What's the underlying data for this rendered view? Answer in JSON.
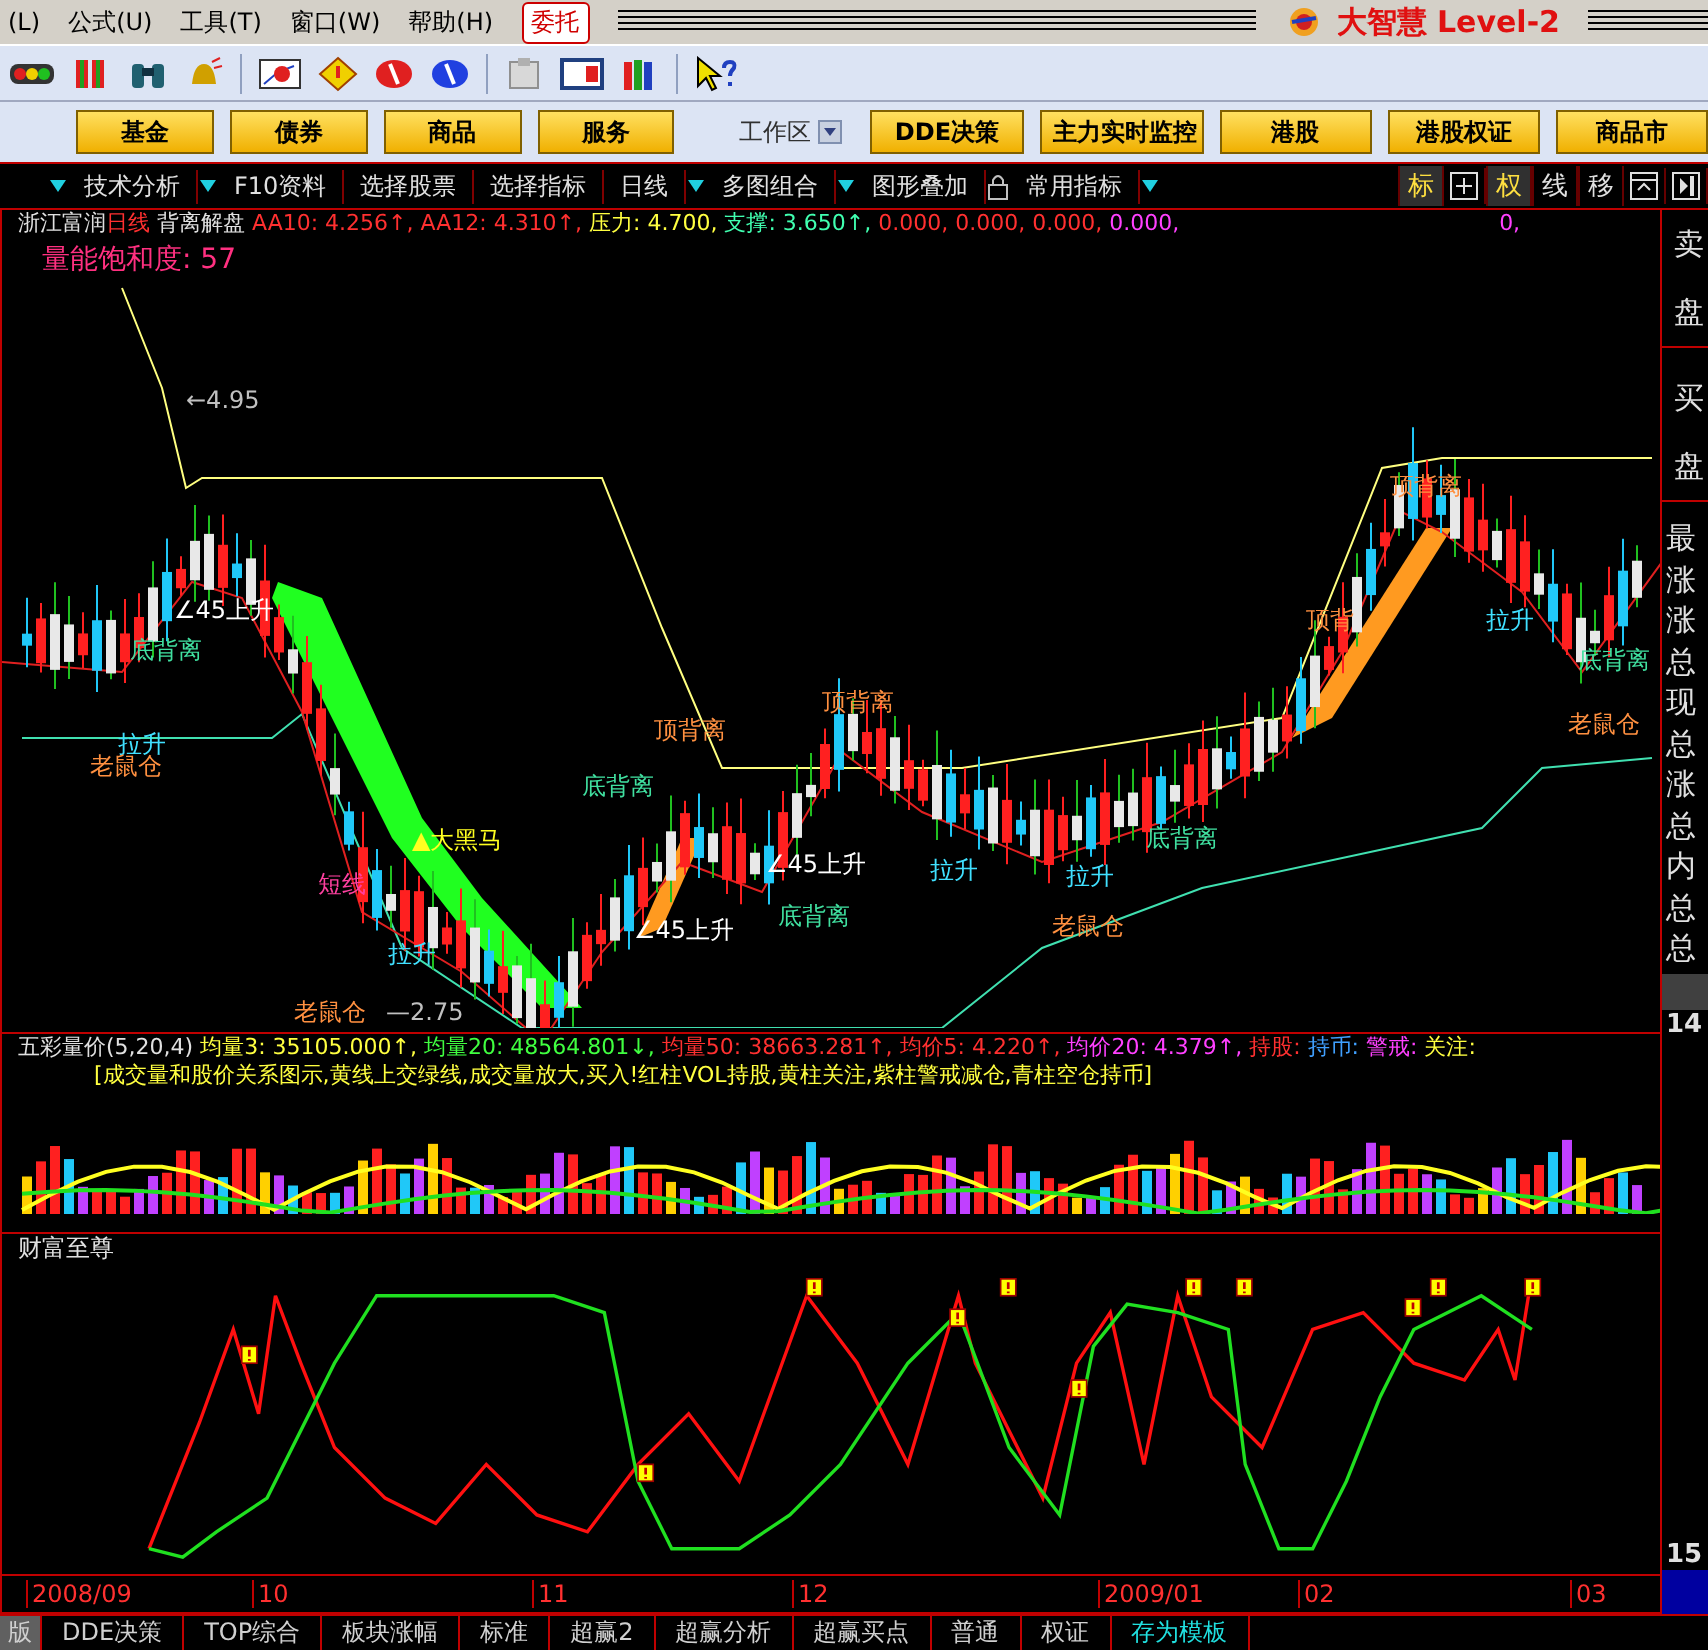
{
  "menu": {
    "items": [
      "(L)",
      "公式(U)",
      "工具(T)",
      "窗口(W)",
      "帮助(H)"
    ],
    "trade_button": "委托",
    "app_title": "大智慧 Level-2"
  },
  "category_bar": [
    {
      "kind": "button",
      "label": "基金"
    },
    {
      "kind": "button",
      "label": "债券"
    },
    {
      "kind": "button",
      "label": "商品"
    },
    {
      "kind": "button",
      "label": "服务"
    },
    {
      "kind": "menu",
      "label": "工作区"
    },
    {
      "kind": "button",
      "label": "DDE决策"
    },
    {
      "kind": "button",
      "label": "主力实时监控"
    },
    {
      "kind": "button",
      "label": "港股"
    },
    {
      "kind": "button",
      "label": "港股权证"
    },
    {
      "kind": "button",
      "label": "商品市"
    }
  ],
  "function_bar": [
    {
      "label": "技术分析",
      "dropdown": true
    },
    {
      "label": "F10资料",
      "dropdown": false
    },
    {
      "label": "选择股票",
      "dropdown": false
    },
    {
      "label": "选择指标",
      "dropdown": false
    },
    {
      "label": "日线",
      "dropdown": true
    },
    {
      "label": "多图组合",
      "dropdown": true
    },
    {
      "label": "图形叠加",
      "dropdown": false
    },
    {
      "label": "常用指标",
      "dropdown": true
    }
  ],
  "view_buttons": [
    {
      "kind": "label",
      "label": "标",
      "selected": true
    },
    {
      "kind": "grid",
      "selected": false
    },
    {
      "kind": "label",
      "label": "权",
      "selected": true
    },
    {
      "kind": "label",
      "label": "线",
      "selected": false
    },
    {
      "kind": "label",
      "label": "移",
      "selected": false
    },
    {
      "kind": "window",
      "selected": false
    },
    {
      "kind": "panel",
      "selected": false
    }
  ],
  "main_chart": {
    "header": [
      {
        "text": "浙江富润",
        "color": "#e0e0e0"
      },
      {
        "text": "日线",
        "color": "#ff3030"
      },
      {
        "text": " 背离解盘 ",
        "color": "#e0e0e0"
      },
      {
        "text": "AA10: 4.256↑,",
        "color": "#ff3030"
      },
      {
        "text": " AA12: 4.310↑,",
        "color": "#ff3030"
      },
      {
        "text": " 压力: 4.700,",
        "color": "#ffff40"
      },
      {
        "text": " 支撑: 3.650↑,",
        "color": "#40ffb0"
      },
      {
        "text": " 0.000, 0.000, 0.000,",
        "color": "#ff3030"
      },
      {
        "text": " 0.000,",
        "color": "#ff40ff"
      }
    ],
    "header_tail": {
      "text": "0,",
      "color": "#ff40ff"
    },
    "saturation": "量能饱和度: 57",
    "annotations": [
      {
        "text": "←4.95",
        "color": "#c0c0c0"
      },
      {
        "text": "∠45上升",
        "color": "#ffffff"
      },
      {
        "text": "底背离",
        "color": "#40e0a0"
      },
      {
        "text": "拉升",
        "color": "#40e0ff"
      },
      {
        "text": "老鼠仓",
        "color": "#ff9040"
      },
      {
        "text": "▲大黑马",
        "color": "#ffff20"
      },
      {
        "text": "短线",
        "color": "#ff40a0"
      },
      {
        "text": "拉升",
        "color": "#40e0ff"
      },
      {
        "text": "顶背离",
        "color": "#ff9040"
      },
      {
        "text": "底背离",
        "color": "#40e0a0"
      },
      {
        "text": "∠45上升",
        "color": "#ffffff"
      },
      {
        "text": "∠45上升",
        "color": "#ffffff"
      },
      {
        "text": "底背离",
        "color": "#40e0a0"
      },
      {
        "text": "顶背离",
        "color": "#ff9040"
      },
      {
        "text": "拉升",
        "color": "#40e0ff"
      },
      {
        "text": "拉升",
        "color": "#40e0ff"
      },
      {
        "text": "底背离",
        "color": "#40e0a0"
      },
      {
        "text": "老鼠仓",
        "color": "#ff9040"
      },
      {
        "text": "顶背离",
        "color": "#ff9040"
      },
      {
        "text": "顶背",
        "color": "#ff9040"
      },
      {
        "text": "拉升",
        "color": "#40e0ff"
      },
      {
        "text": "底背离",
        "color": "#40e0a0"
      },
      {
        "text": "老鼠仓",
        "color": "#ff9040"
      },
      {
        "text": "—2.75",
        "color": "#c0c0c0"
      },
      {
        "text": "老鼠仓",
        "color": "#ff9040"
      }
    ]
  },
  "volume_panel": {
    "header": [
      {
        "text": "五彩量价(5,20,4)",
        "color": "#e0e0e0"
      },
      {
        "text": " 均量3: 35105.000↑,",
        "color": "#ffff40"
      },
      {
        "text": " 均量20: 48564.801↓,",
        "color": "#40ff40"
      },
      {
        "text": " 均量50: 38663.281↑,",
        "color": "#ff3030"
      },
      {
        "text": " 均价5: 4.220↑,",
        "color": "#ff3030"
      },
      {
        "text": " 均价20: 4.379↑,",
        "color": "#ff40ff"
      },
      {
        "text": " 持股:",
        "color": "#ff3030"
      },
      {
        "text": " 持币:",
        "color": "#40a0ff"
      },
      {
        "text": " 警戒:",
        "color": "#ff40ff"
      },
      {
        "text": " 关注:",
        "color": "#ffff40"
      }
    ],
    "note": "[成交量和股价关系图示,黄线上交绿线,成交量放大,买入!红柱VOL持股,黄柱关注,紫柱警戒减仓,青柱空仓持币]"
  },
  "wealth_panel": {
    "title": "财富至尊"
  },
  "date_axis": [
    "2008/09",
    "10",
    "11",
    "12",
    "2009/01",
    "02",
    "03"
  ],
  "right_panel": {
    "rows": [
      "卖",
      "盘",
      "买",
      "盘",
      "最",
      "涨",
      "涨",
      "总",
      "现",
      "总",
      "涨",
      "总",
      "内",
      "总",
      "总"
    ],
    "axis_labels": [
      "14",
      "15"
    ]
  },
  "bottom_tabs": [
    {
      "label": "版",
      "selected": false
    },
    {
      "label": "DDE决策",
      "selected": false
    },
    {
      "label": "TOP综合",
      "selected": false
    },
    {
      "label": "板块涨幅",
      "selected": false
    },
    {
      "label": "标准",
      "selected": false
    },
    {
      "label": "超赢2",
      "selected": false
    },
    {
      "label": "超赢分析",
      "selected": false
    },
    {
      "label": "超赢买点",
      "selected": false
    },
    {
      "label": "普通",
      "selected": false
    },
    {
      "label": "权证",
      "selected": false
    },
    {
      "label": "存为模板",
      "selected": true
    }
  ]
}
